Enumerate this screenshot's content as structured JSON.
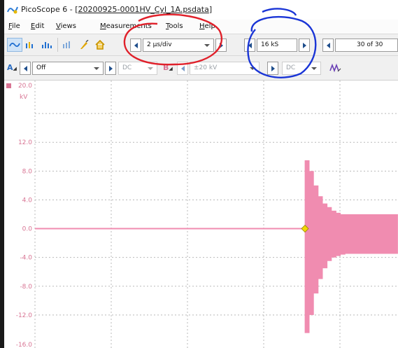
{
  "window": {
    "title_prefix": "PicoScope 6 - [",
    "title_file": "20200925-0001HV_Cyl_1A.psdata",
    "title_suffix": "]"
  },
  "menu": {
    "items": [
      {
        "key": "F",
        "rest": "ile"
      },
      {
        "key": "E",
        "rest": "dit"
      },
      {
        "key": "V",
        "rest": "iews"
      },
      {
        "key": "M",
        "rest": "easurements"
      },
      {
        "key": "T",
        "rest": "ools"
      },
      {
        "key": "H",
        "rest": "elp"
      }
    ]
  },
  "toolbar1": {
    "timebase": "2 µs/div",
    "samples": "16 kS",
    "buffer": "30 of 30"
  },
  "toolbar2": {
    "channel_a_label": "A",
    "channel_a_coupling_value": "Off",
    "channel_a_dc": "DC",
    "channel_b_label": "B",
    "channel_b_range": "±20 kV",
    "channel_b_dc": "DC"
  },
  "plot": {
    "y_unit": "kV",
    "y_tick_labels": [
      "20.0",
      "12.0",
      "8.0",
      "4.0",
      "0.0",
      "-4.0",
      "-8.0",
      "-12.0",
      "-16.0"
    ],
    "trace_color": "#f08cb0",
    "trigger_marker_color": "#f3d600"
  },
  "colors": {
    "annotation_red": "#e0202a",
    "annotation_blue": "#1a35d6"
  },
  "chart_data": {
    "type": "line",
    "title": "",
    "xlabel": "",
    "ylabel": "kV",
    "ylim": [
      -16,
      20
    ],
    "grid": true,
    "series": [
      {
        "values_description_kv_baseline": 0.0,
        "burst_peak_kv": 9.5,
        "burst_trough_kv": -14.5,
        "values": [
          0,
          0,
          0,
          0,
          0,
          0,
          0,
          0,
          0,
          0,
          0,
          0,
          0,
          0,
          0,
          0,
          0,
          9.5,
          -14.5,
          8,
          -12,
          6,
          -9,
          4.5,
          -7,
          3.5,
          -5.5,
          3,
          -4.5,
          2.5,
          -4,
          2.2,
          -3.8,
          2,
          -3.6,
          2,
          -3.5,
          2,
          -3.5,
          2,
          -3.5,
          2,
          -3.5
        ]
      }
    ]
  }
}
